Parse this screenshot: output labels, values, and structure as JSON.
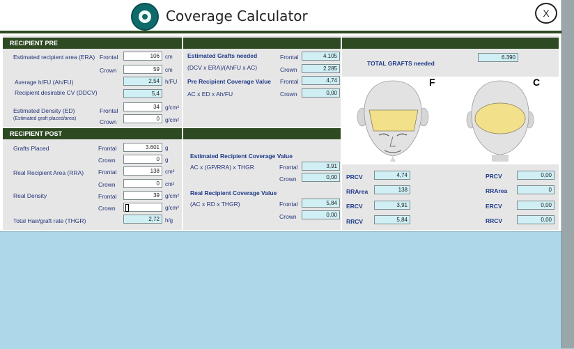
{
  "app": {
    "title": "Coverage Calculator"
  },
  "pre": {
    "header": "RECIPIENT PRE",
    "era_label": "Estimated recipient area (ERA)",
    "frontal_label": "Frontal",
    "crown_label": "Crown",
    "era_frontal": "106",
    "era_crown": "59",
    "unit_cm": "cm",
    "ahfu_label": "Average h/FU (Ah/FU)",
    "ahfu_value": "2,54",
    "ahfu_unit": "h/FU",
    "ddcv_label": "Recipient desirable CV (DDCV)",
    "ddcv_value": "5,4",
    "ed_label": "Estimated Density (ED)",
    "ed_sub": "(Estimated graft placed/area)",
    "ed_frontal": "34",
    "ed_crown": "0",
    "unit_gcm2": "g/cm²"
  },
  "grafts_needed": {
    "title": "Estimated Grafts needed",
    "formula": "(DCV x ERA)/(AhFU x AC)",
    "frontal_label": "Frontal",
    "crown_label": "Crown",
    "frontal": "4.105",
    "crown": "2.285",
    "prcv_title": "Pre Recipient Coverage Value",
    "prcv_formula": "AC x ED x Ah/FU",
    "prcv_frontal": "4,74",
    "prcv_crown": "0,00"
  },
  "total": {
    "label": "TOTAL GRAFTS needed",
    "value": "6.390"
  },
  "heads": {
    "front_letter": "F",
    "crown_letter": "C"
  },
  "post": {
    "header": "RECIPIENT POST",
    "grafts_label": "Grafts Placed",
    "frontal_label": "Frontal",
    "crown_label": "Crown",
    "grafts_frontal": "3.601",
    "grafts_crown": "0",
    "unit_g": "g",
    "rra_label": "Real Recipient Area (RRA)",
    "rra_frontal": "138",
    "rra_crown": "0",
    "unit_cm2": "cm²",
    "rd_label": "Real Density",
    "rd_frontal": "39",
    "rd_crown": "",
    "unit_gcm2": "g/cm²",
    "thgr_label": "Total Hair/graft rate (THGR)",
    "thgr_value": "2,72",
    "unit_hg": "h/g"
  },
  "coverage": {
    "ercv_title": "Estimated Recipient Coverage Value",
    "ercv_formula": "AC x (GP/RRA) x THGR",
    "ercv_frontal": "3,91",
    "ercv_crown": "0,00",
    "rrcv_title": "Real Recipient Coverage Value",
    "rrcv_formula": "(AC x RD x THGR)",
    "rrcv_frontal": "5,84",
    "rrcv_crown": "0,00",
    "frontal_label": "Frontal",
    "crown_label": "Crown"
  },
  "summary": {
    "left": [
      {
        "label": "PRCV",
        "value": "4,74"
      },
      {
        "label": "RRArea",
        "value": "138"
      },
      {
        "label": "ERCV",
        "value": "3,91"
      },
      {
        "label": "RRCV",
        "value": "5,84"
      }
    ],
    "right": [
      {
        "label": "PRCV",
        "value": "0,00"
      },
      {
        "label": "RRArea",
        "value": "0"
      },
      {
        "label": "ERCV",
        "value": "0,00"
      },
      {
        "label": "RRCV",
        "value": "0,00"
      }
    ]
  },
  "colors": {
    "header_green": "#2e4a23",
    "cyan_field": "#cfeff4",
    "label_blue": "#24347a",
    "bottom_blue": "#add8ea"
  }
}
